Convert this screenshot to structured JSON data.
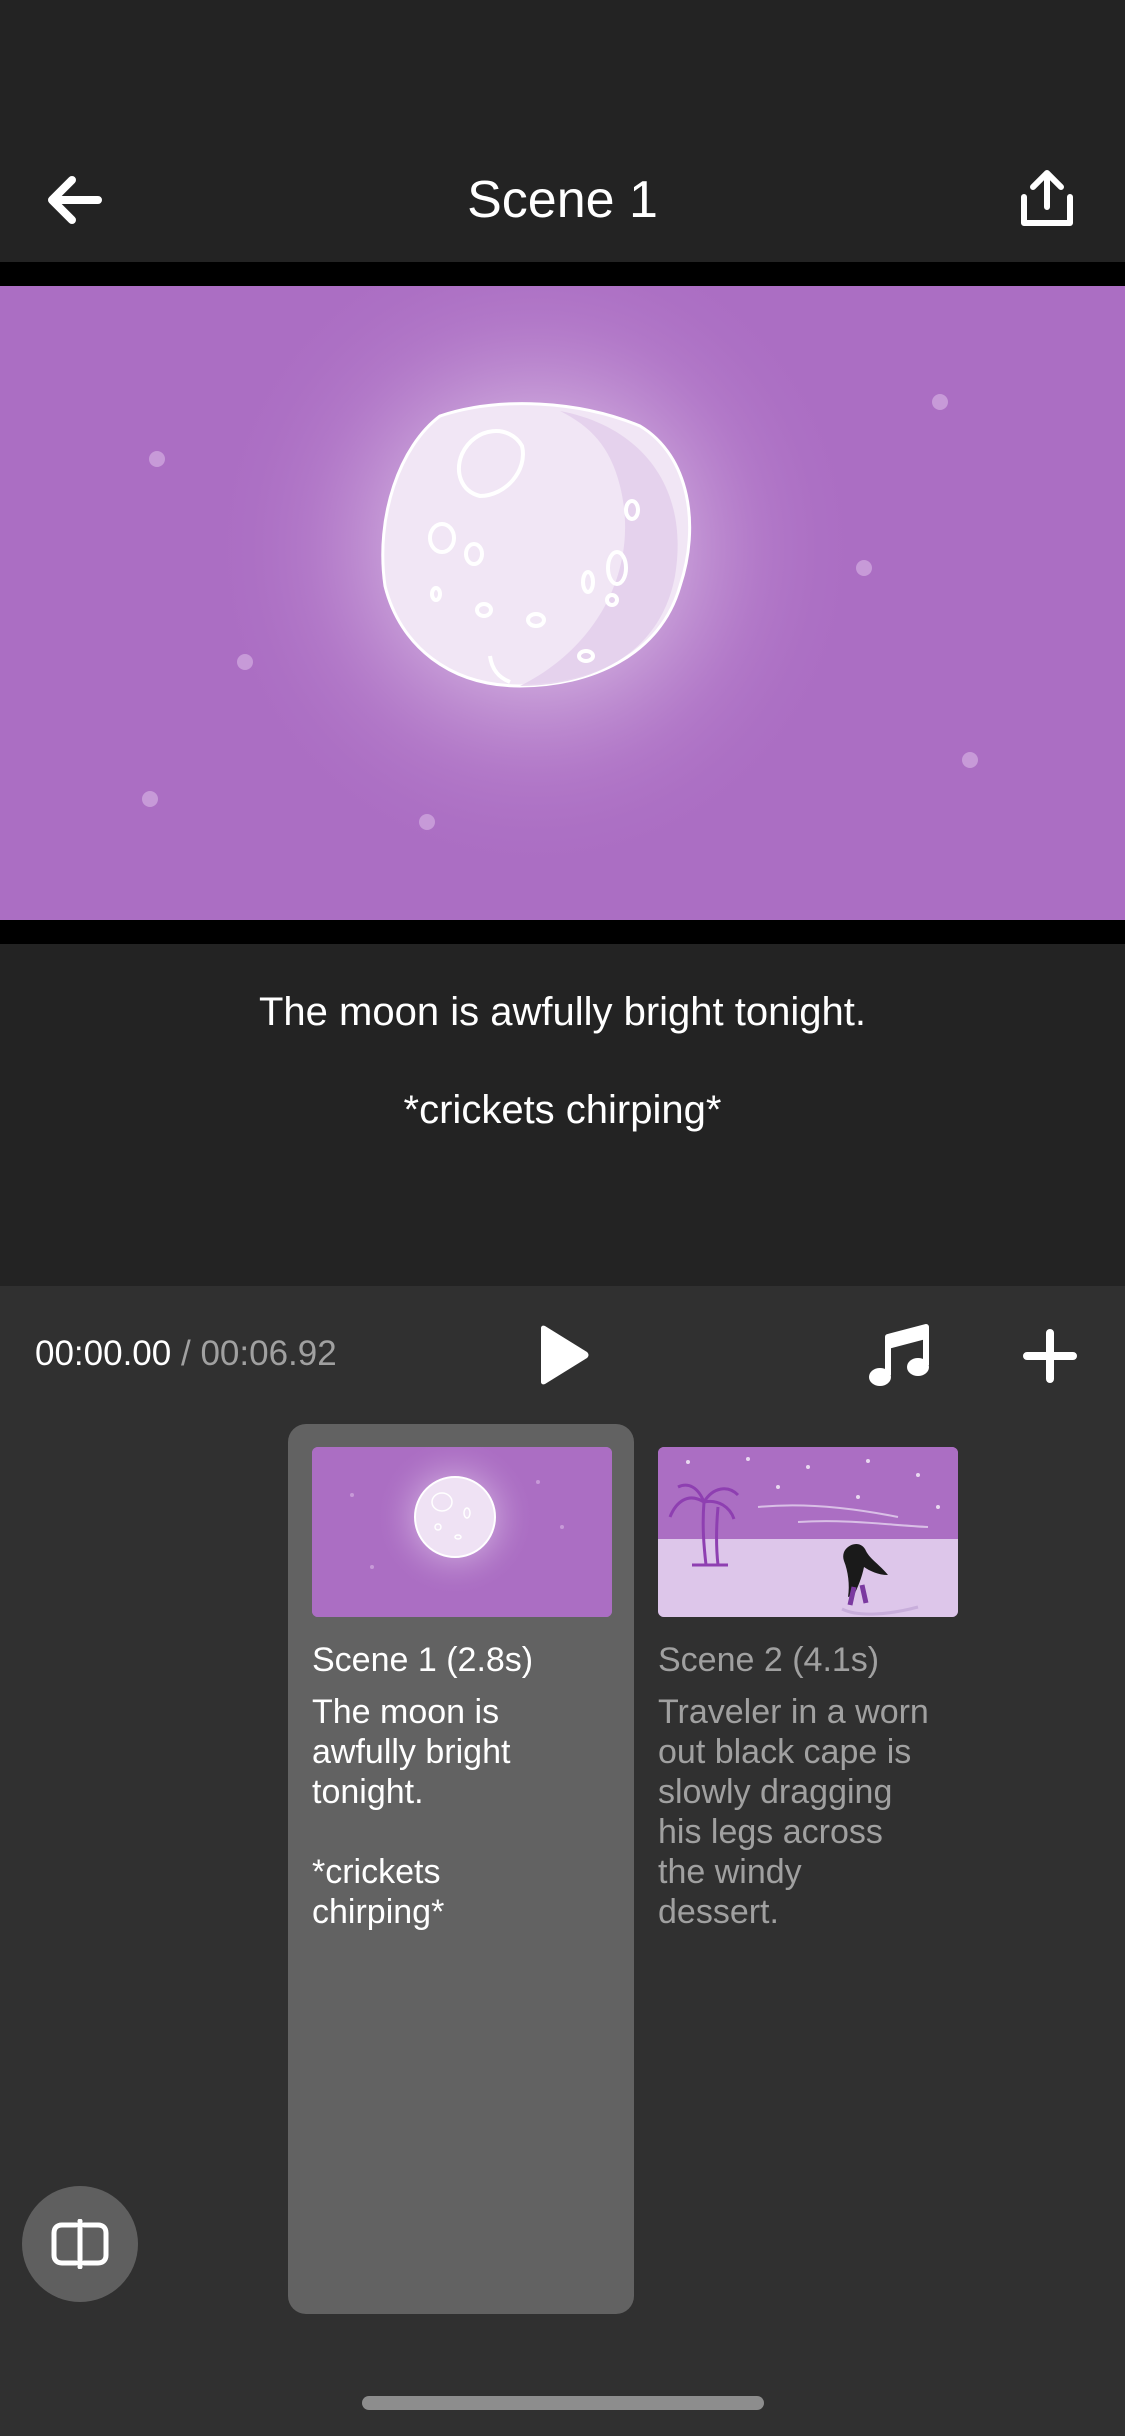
{
  "header": {
    "title": "Scene 1",
    "back_icon": "arrow-left-icon",
    "share_icon": "share-icon"
  },
  "caption": {
    "line1": "The moon is awfully bright tonight.",
    "line2": "*crickets chirping*"
  },
  "timeline": {
    "current_time": "00:00.00",
    "separator": "/",
    "total_time": "00:06.92",
    "play_icon": "play-icon",
    "music_icon": "music-note-icon",
    "add_icon": "plus-icon"
  },
  "scenes": [
    {
      "title": "Scene 1 (2.8s)",
      "description": "The moon is\nawfully bright\ntonight.\n\n*crickets\nchirping*",
      "selected": true
    },
    {
      "title": "Scene 2 (4.1s)",
      "description": "Traveler in a worn\nout black cape is\nslowly dragging\nhis legs across\nthe windy\ndessert.",
      "selected": false
    }
  ],
  "colors": {
    "background": "#232323",
    "panel": "#303030",
    "selected_card": "#626262",
    "scene_purple": "#ab6ec3",
    "muted_text": "#a0a0a0"
  }
}
